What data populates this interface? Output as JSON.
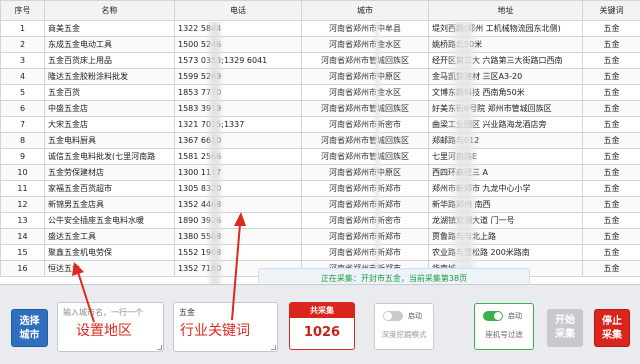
{
  "table": {
    "headers": [
      "序号",
      "名称",
      "电话",
      "城市",
      "地址",
      "关键词"
    ],
    "rows": [
      {
        "no": "1",
        "name": "商美五金",
        "phone": "1322        5844",
        "city": "河南省郑州市中牟县",
        "address": "堤刘西路(郑州    工机械物流园东北侧)",
        "keyword": "五金"
      },
      {
        "no": "2",
        "name": "东成五金电动工具",
        "phone": "1500        5246",
        "city": "河南省郑州市金水区",
        "address": "姚桥路北50米",
        "keyword": "五金"
      },
      {
        "no": "3",
        "name": "五金百货床上用品",
        "phone": "1573    0353;1329      6041",
        "city": "河南省郑州市管城回族区",
        "address": "经开区第三大     六路第三大街路口西南",
        "keyword": "五金"
      },
      {
        "no": "4",
        "name": "隆达五金胶粉涂料批发",
        "phone": "1599        5269",
        "city": "河南省郑州市中原区",
        "address": "金马凯旋建材     三区A3-20",
        "keyword": "五金"
      },
      {
        "no": "5",
        "name": "五金百货",
        "phone": "1853        7770",
        "city": "河南省郑州市金水区",
        "address": "文博东路科技     西南角50米",
        "keyword": "五金"
      },
      {
        "no": "6",
        "name": "中盛五金店",
        "phone": "1583        3919",
        "city": "河南省郑州市管城回族区",
        "address": "好美东街6号院     郑州市管城回族区",
        "keyword": "五金"
      },
      {
        "no": "7",
        "name": "大宋五金店",
        "phone": "1321    7025;1337     ",
        "city": "河南省郑州市新密市",
        "address": "曲梁工业园区     兴业路海龙酒店旁",
        "keyword": "五金"
      },
      {
        "no": "8",
        "name": "五金电料厨具",
        "phone": "1367        6610",
        "city": "河南省郑州市管城回族区",
        "address": "郑邮路与012     ",
        "keyword": "五金"
      },
      {
        "no": "9",
        "name": "诚信五金电料批发(七里河南路",
        "phone": "1581        2566",
        "city": "河南省郑州市管城回族区",
        "address": "七里河南路E     ",
        "keyword": "五金"
      },
      {
        "no": "10",
        "name": "五金劳保建材店",
        "phone": "1300        1117",
        "city": "河南省郑州市中原区",
        "address": "西四环森近三     A",
        "keyword": "五金"
      },
      {
        "no": "11",
        "name": "家福五金百货超市",
        "phone": "1305        8320",
        "city": "河南省郑州市新郑市",
        "address": "郑州市新郑市     九龙中心小学",
        "keyword": "五金"
      },
      {
        "no": "12",
        "name": "新锦男五金店具",
        "phone": "1352        4468",
        "city": "河南省郑州市新郑市",
        "address": "新华路郑州     南西",
        "keyword": "五金"
      },
      {
        "no": "13",
        "name": "公牛安全插座五金电料水暖",
        "phone": "1890        3926",
        "city": "河南省郑州市新密市",
        "address": "龙湖镇双湖大道     门一号",
        "keyword": "五金"
      },
      {
        "no": "14",
        "name": "盛达五金工具",
        "phone": "1380        5508",
        "city": "河南省郑州市新郑市",
        "address": "贾鲁路与与北上路     ",
        "keyword": "五金"
      },
      {
        "no": "15",
        "name": "聚鑫五金机电劳保",
        "phone": "1552        1908",
        "city": "河南省郑州市新郑市",
        "address": "农业路与雪松路     200米路南",
        "keyword": "五金"
      },
      {
        "no": "16",
        "name": "恒达五金",
        "phone": "1352        7180",
        "city": "河南省郑州市新郑市",
        "address": "华南城      ",
        "keyword": "五金"
      }
    ]
  },
  "status_text": "正在采集：开封市五金，当前采集第38页",
  "panel": {
    "select_city_button": "选择城市",
    "city_input_placeholder": "输入城市名，一行一个",
    "keyword_input_value": "五金",
    "counter_label": "共采集",
    "counter_value": "1026",
    "toggle_deep": {
      "state": "启动",
      "label": "深度挖掘模式"
    },
    "toggle_filter": {
      "state": "启动",
      "label": "座机号过滤"
    },
    "start_button": "开始采集",
    "stop_button": "停止采集"
  },
  "annotations": {
    "set_region": "设置地区",
    "industry_keyword": "行业关键词"
  },
  "colors": {
    "primary_blue": "#2f6fbf",
    "stop_red": "#d9251c",
    "toggle_green": "#3bb34a",
    "status_green": "#1b9b3a",
    "annotation_red": "#e0281e"
  }
}
